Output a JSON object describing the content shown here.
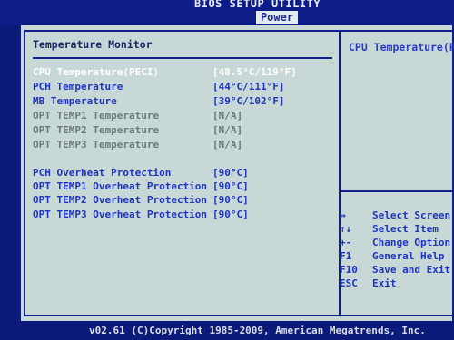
{
  "app": {
    "title": "BIOS SETUP UTILITY",
    "active_tab": "Power"
  },
  "section": {
    "title": "Temperature Monitor"
  },
  "rows": [
    {
      "label": "CPU Temperature(PECI)",
      "value": "[48.5°C/119°F]",
      "style": "highlight"
    },
    {
      "label": "PCH Temperature",
      "value": "[44°C/111°F]",
      "style": "blue"
    },
    {
      "label": "MB Temperature",
      "value": "[39°C/102°F]",
      "style": "blue"
    },
    {
      "label": "OPT TEMP1 Temperature",
      "value": "[N/A]",
      "style": "grey"
    },
    {
      "label": "OPT TEMP2 Temperature",
      "value": "[N/A]",
      "style": "grey"
    },
    {
      "label": "OPT TEMP3 Temperature",
      "value": "[N/A]",
      "style": "grey"
    },
    {
      "label": "PCH Overheat Protection",
      "value": "[90°C]",
      "style": "blue"
    },
    {
      "label": "OPT TEMP1 Overheat Protection",
      "value": "[90°C]",
      "style": "blue"
    },
    {
      "label": "OPT TEMP2 Overheat Protection",
      "value": "[90°C]",
      "style": "blue"
    },
    {
      "label": "OPT TEMP3 Overheat Protection",
      "value": "[90°C]",
      "style": "blue"
    }
  ],
  "help": {
    "title": "CPU Temperature(PE",
    "keys": [
      {
        "key": "↔",
        "action": "Select Screen"
      },
      {
        "key": "↑↓",
        "action": "Select Item"
      },
      {
        "key": "+-",
        "action": "Change Option"
      },
      {
        "key": "F1",
        "action": "General Help"
      },
      {
        "key": "F10",
        "action": "Save and Exit"
      },
      {
        "key": "ESC",
        "action": "Exit"
      }
    ]
  },
  "footer": {
    "copyright": "v02.61 (C)Copyright 1985-2009, American Megatrends, Inc."
  },
  "colors": {
    "background": "#0c1a7a",
    "panel": "#c8d8d6",
    "highlight": "#ffffff",
    "item_blue": "#1f34c0",
    "disabled_grey": "#6b7a80"
  }
}
